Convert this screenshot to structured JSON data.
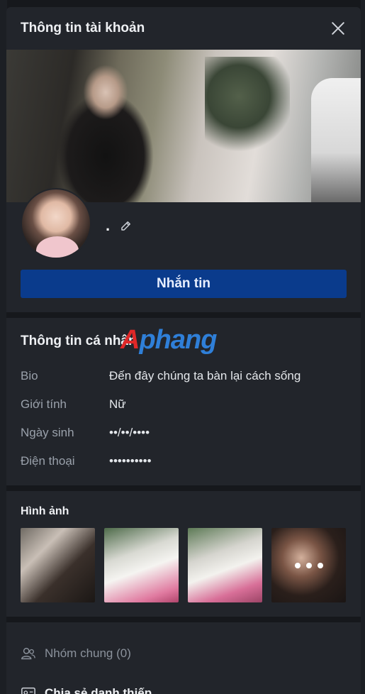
{
  "header": {
    "title": "Thông tin tài khoản"
  },
  "profile": {
    "name": "."
  },
  "actions": {
    "message_label": "Nhắn tin"
  },
  "watermark": {
    "part1": "A",
    "part2": "phang"
  },
  "personal": {
    "title": "Thông tin cá nhân",
    "rows": [
      {
        "label": "Bio",
        "value": "Đến đây chúng ta bàn lại cách sống"
      },
      {
        "label": "Giới tính",
        "value": "Nữ"
      },
      {
        "label": "Ngày sinh",
        "value": "••/••/••••"
      },
      {
        "label": "Điện thoại",
        "value": "••••••••••"
      }
    ]
  },
  "photos": {
    "title": "Hình ảnh",
    "count_shown": 4
  },
  "list": {
    "groups_label": "Nhóm chung (0)",
    "share_label": "Chia sẻ danh thiếp"
  },
  "colors": {
    "accent": "#0a3b8c",
    "panel": "#22252b",
    "background": "#16181c"
  }
}
